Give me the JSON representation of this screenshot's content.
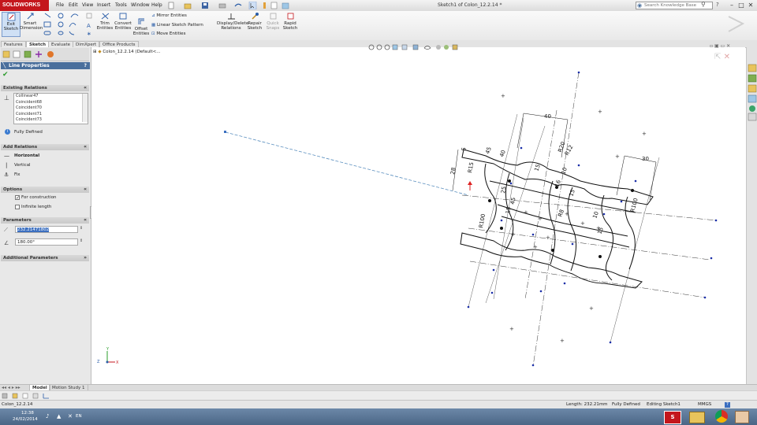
{
  "app": {
    "logo_text": "SOLIDWORKS",
    "document_title": "Sketch1 of Colon_12.2.14 *",
    "search_placeholder": "Search Knowledge Base"
  },
  "menu": [
    "File",
    "Edit",
    "View",
    "Insert",
    "Tools",
    "Window",
    "Help"
  ],
  "ribbon": {
    "exit_sketch": "Exit Sketch",
    "smart_dimension": "Smart Dimension",
    "trim_entities": "Trim Entities",
    "convert_entities": "Convert Entities",
    "offset_entities": "Offset Entities",
    "mirror_entities": "Mirror Entities",
    "linear_sketch_pattern": "Linear Sketch Pattern",
    "move_entities": "Move Entities",
    "display_delete_relations": "Display/Delete Relations",
    "repair_sketch": "Repair Sketch",
    "quick_snaps": "Quick Snaps",
    "rapid_sketch": "Rapid Sketch"
  },
  "command_tabs": [
    "Features",
    "Sketch",
    "Evaluate",
    "DimXpert",
    "Office Products"
  ],
  "active_command_tab": "Sketch",
  "property_manager": {
    "title": "Line Properties",
    "help": "?",
    "existing_relations": {
      "header": "Existing Relations",
      "items": [
        "Collinear47",
        "Coincident68",
        "Coincident70",
        "Coincident71",
        "Coincident73"
      ],
      "status": "Fully Defined"
    },
    "add_relations": {
      "header": "Add Relations",
      "items": [
        "Horizontal",
        "Vertical",
        "Fix"
      ]
    },
    "options": {
      "header": "Options",
      "for_construction": "For construction",
      "for_construction_checked": true,
      "infinite_length": "Infinite length",
      "infinite_length_checked": false
    },
    "parameters": {
      "header": "Parameters",
      "length": "232.21471802",
      "angle": "180.00°"
    },
    "additional": {
      "header": "Additional Parameters"
    }
  },
  "tree": {
    "root_label": "Colon_12.2.14  (Default<..."
  },
  "dimensions": [
    "40",
    "30",
    "28",
    "R15",
    "R100",
    "R100",
    "R12",
    "R20",
    "5",
    "45",
    "40",
    "15",
    "10",
    "25",
    "15",
    "45",
    "R8",
    "10",
    "15",
    "15",
    "16"
  ],
  "bottom_tabs": [
    "Model",
    "Motion Study 1"
  ],
  "status": {
    "left": "Colon_12.2.14",
    "length": "Length: 232.21mm",
    "state": "Fully Defined",
    "editing": "Editing Sketch1",
    "units": "MMGS",
    "help": "?"
  },
  "taskbar": {
    "time": "12:38",
    "date": "24/02/2014",
    "lang": "EN"
  },
  "colors": {
    "brand_red": "#c4161c",
    "pm_title_blue": "#4a6f9c",
    "taskbar_blue": "#5a7899",
    "sketch_blue": "#1a2ea8",
    "construction_line": "#5b8fbf"
  }
}
